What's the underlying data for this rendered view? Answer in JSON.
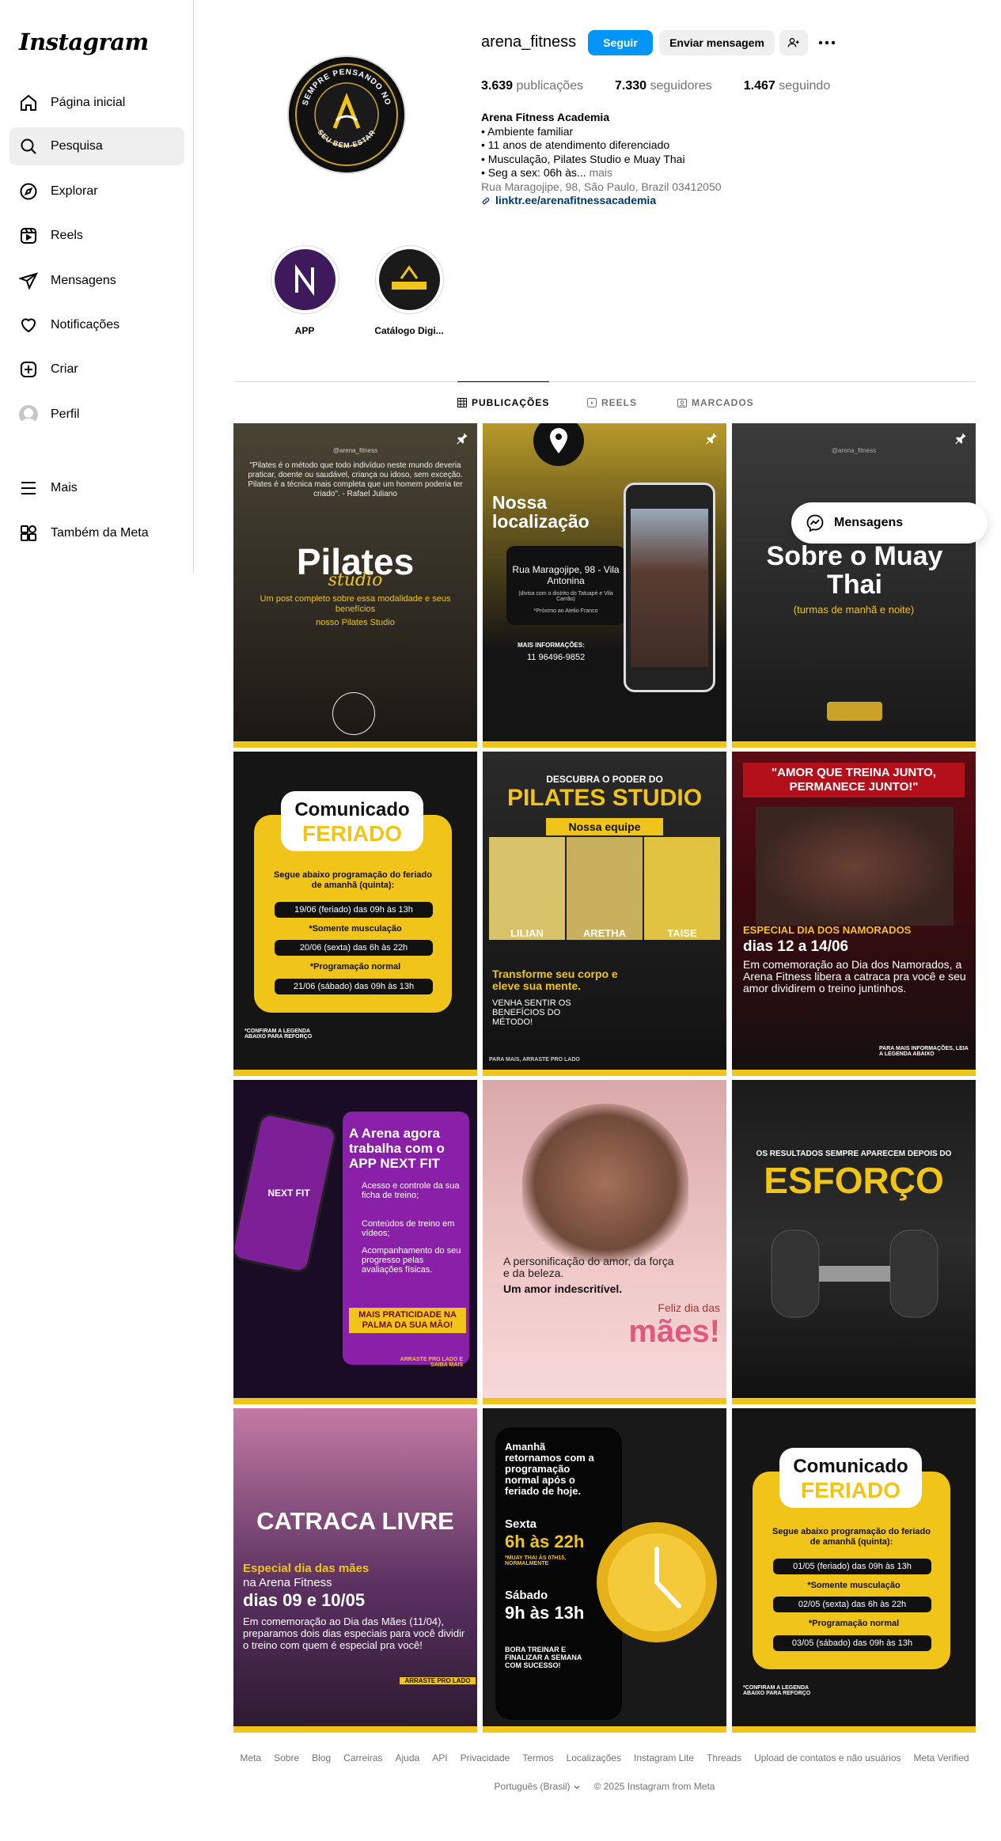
{
  "app": {
    "logo": "Instagram"
  },
  "sidebar": {
    "items": [
      {
        "label": "Página inicial",
        "icon": "home-icon"
      },
      {
        "label": "Pesquisa",
        "icon": "search-icon"
      },
      {
        "label": "Explorar",
        "icon": "compass-icon"
      },
      {
        "label": "Reels",
        "icon": "reels-icon"
      },
      {
        "label": "Mensagens",
        "icon": "paper-plane-icon"
      },
      {
        "label": "Notificações",
        "icon": "heart-icon"
      },
      {
        "label": "Criar",
        "icon": "plus-square-icon"
      },
      {
        "label": "Perfil",
        "icon": "avatar"
      },
      {
        "label": "Mais",
        "icon": "menu-icon"
      },
      {
        "label": "Também da Meta",
        "icon": "meta-apps-icon"
      }
    ]
  },
  "profile": {
    "username": "arena_fitness",
    "follow_label": "Seguir",
    "message_label": "Enviar mensagem",
    "stats": {
      "posts_value": "3.639",
      "posts_label": "publicações",
      "followers_value": "7.330",
      "followers_label": "seguidores",
      "following_value": "1.467",
      "following_label": "seguindo"
    },
    "bio": {
      "name": "Arena Fitness Academia",
      "line1": "• Ambiente familiar",
      "line2": "• 11 anos de atendimento diferenciado",
      "line3": "• Musculação, Pilates Studio e Muay Thai",
      "line4": "• Seg a sex: 06h às...",
      "more": "mais",
      "address": "Rua Maragojipe, 98, São Paulo, Brazil 03412050",
      "link": "linktr.ee/arenafitnessacademia"
    },
    "logo_text": {
      "top": "SEMPRE PENSANDO NO",
      "bottom": "SEU BEM-ESTAR"
    }
  },
  "highlights": [
    {
      "label": "APP"
    },
    {
      "label": "Catálogo Digi..."
    }
  ],
  "tabs": [
    {
      "label": "PUBLICAÇÕES"
    },
    {
      "label": "REELS"
    },
    {
      "label": "MARCADOS"
    }
  ],
  "floating_messages": {
    "label": "Mensagens"
  },
  "posts": {
    "p1": {
      "handle": "@arena_fitness",
      "quote": "\"Pilates é o método que todo indivíduo neste mundo deveria praticar, doente ou saudável, criança ou idoso, sem exceção. Pilates é a técnica mais completa que um homem poderia ter criado\". - Rafael Juliano",
      "title": "Pilates",
      "script": "studio",
      "sub": "Um post completo sobre essa modalidade e seus benefícios",
      "sub2": "nosso Pilates Studio"
    },
    "p2": {
      "title": "Nossa localização",
      "address": "Rua Maragojipe, 98 - Vila Antonina",
      "note": "(divisa com o distrito do Tatuapé e Vila Carrão)",
      "note2": "*Próximo ao Atelio Franco",
      "info_label": "MAIS INFORMAÇÕES:",
      "phone": "11 96496-9852"
    },
    "p3": {
      "handle": "@arena_fitness",
      "title": "Sobre o Muay Thai",
      "sub": "(turmas de manhã e noite)"
    },
    "p4": {
      "title1": "Comunicado",
      "title2": "FERIADO",
      "intro": "Segue abaixo programação do feriado de amanhã (quinta):",
      "r1": "19/06 (feriado) das 09h às 13h",
      "n1": "*Somente musculação",
      "r2": "20/06 (sexta) das 6h às 22h",
      "n2": "*Programação normal",
      "r3": "21/06 (sábado) das 09h às 13h",
      "foot": "*CONFIRAM A LEGENDA ABAIXO PARA REFORÇO"
    },
    "p5": {
      "kicker": "DESCUBRA O PODER DO",
      "title": "PILATES STUDIO",
      "team": "Nossa equipe",
      "n1": "LILIAN",
      "n2": "ARETHA",
      "n3": "TAISE",
      "tag": "Transforme seu corpo e eleve sua mente.",
      "cta": "VENHA SENTIR OS BENEFÍCIOS DO MÉTODO!",
      "foot": "PARA MAIS, ARRASTE PRO LADO"
    },
    "p6": {
      "quote": "\"AMOR QUE TREINA JUNTO, PERMANECE JUNTO!\"",
      "special": "ESPECIAL DIA DOS NAMORADOS",
      "dates": "dias 12 a 14/06",
      "body": "Em comemoração ao Dia dos Namorados, a Arena Fitness libera a catraca pra você e seu amor dividirem o treino juntinhos.",
      "foot": "PARA MAIS INFORMAÇÕES, LEIA A LEGENDA ABAIXO"
    },
    "p7": {
      "title": "A Arena agora trabalha com o APP NEXT FIT",
      "b1": "Acesso e controle da sua ficha de treino;",
      "b2": "Conteúdos de treino em vídeos;",
      "b3": "Acompanhamento do seu progresso pelas avaliações físicas.",
      "banner": "MAIS PRATICIDADE NA PALMA DA SUA MÃO!",
      "swipe": "ARRASTE PRO LADO E SAIBA MAIS",
      "phone_text": "NEXT FIT"
    },
    "p8": {
      "line1": "A personificação do amor, da força e da beleza.",
      "line2": "Um amor indescritível.",
      "greet": "Feliz dia das",
      "big": "mães!"
    },
    "p9": {
      "kicker": "OS RESULTADOS SEMPRE APARECEM DEPOIS DO",
      "big": "ESFORÇO"
    },
    "p10": {
      "title": "CATRACA LIVRE",
      "special": "Especial dia das mães",
      "at": "na Arena Fitness",
      "dates": "dias 09 e 10/05",
      "body": "Em comemoração ao Dia das Mães (11/04), preparamos dois dias especiais para você dividir o treino com quem é especial pra você!",
      "swipe": "ARRASTE PRO LADO"
    },
    "p11": {
      "intro": "Amanhã retornamos com a programação normal após o feriado de hoje.",
      "d1": "Sexta",
      "h1": "6h às 22h",
      "note": "*MUAY THAI ÀS 07H15, NORMALMENTE",
      "d2": "Sábado",
      "h2": "9h às 13h",
      "cta": "BORA TREINAR E FINALIZAR A SEMANA COM SUCESSO!"
    },
    "p12": {
      "title1": "Comunicado",
      "title2": "FERIADO",
      "intro": "Segue abaixo programação do feriado de amanhã (quinta):",
      "r1": "01/05 (feriado) das 09h às 13h",
      "n1": "*Somente musculação",
      "r2": "02/05 (sexta) das 6h às 22h",
      "n2": "*Programação normal",
      "r3": "03/05 (sábado) das 09h às 13h",
      "foot": "*CONFIRAM A LEGENDA ABAIXO PARA REFORÇO"
    }
  },
  "footer": {
    "links": [
      "Meta",
      "Sobre",
      "Blog",
      "Carreiras",
      "Ajuda",
      "API",
      "Privacidade",
      "Termos",
      "Localizações",
      "Instagram Lite",
      "Threads",
      "Upload de contatos e não usuários",
      "Meta Verified"
    ],
    "language": "Português (Brasil)",
    "copyright": "© 2025 Instagram from Meta"
  },
  "colors": {
    "accent": "#0095f6",
    "brand_yellow": "#f0c419",
    "link": "#00376b",
    "muted": "#737373"
  }
}
